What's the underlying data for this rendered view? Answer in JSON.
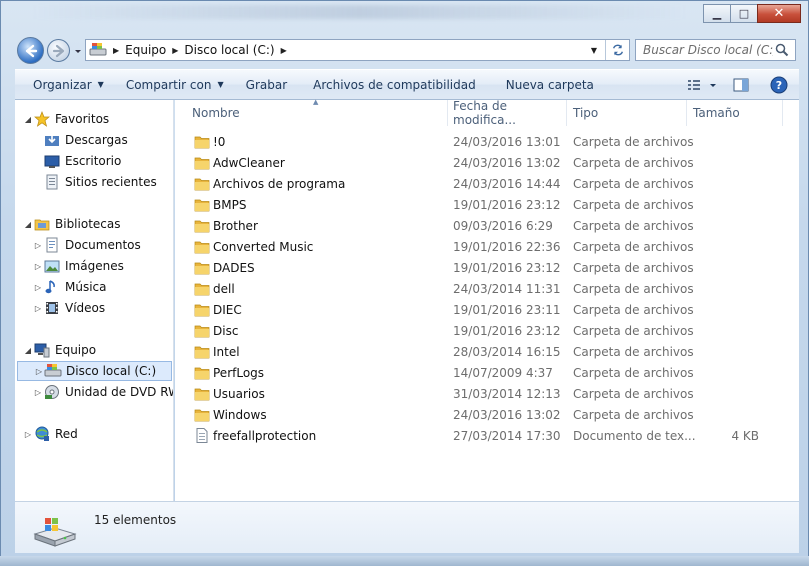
{
  "window": {
    "buttons": {
      "minimize": "▁",
      "maximize": "□",
      "close": "✕"
    }
  },
  "address": {
    "crumbs": [
      "Equipo",
      "Disco local (C:)"
    ]
  },
  "search": {
    "placeholder": "Buscar Disco local (C:)"
  },
  "toolbar": {
    "organize": "Organizar",
    "share": "Compartir con",
    "burn": "Grabar",
    "compat": "Archivos de compatibilidad",
    "new_folder": "Nueva carpeta"
  },
  "sidebar": {
    "favorites": "Favoritos",
    "fav_items": [
      "Descargas",
      "Escritorio",
      "Sitios recientes"
    ],
    "libraries": "Bibliotecas",
    "lib_items": [
      "Documentos",
      "Imágenes",
      "Música",
      "Vídeos"
    ],
    "computer": "Equipo",
    "comp_items": [
      "Disco local (C:)",
      "Unidad de DVD RW ("
    ],
    "network": "Red"
  },
  "columns": {
    "name": "Nombre",
    "date": "Fecha de modifica...",
    "type": "Tipo",
    "size": "Tamaño"
  },
  "files": [
    {
      "name": "!0",
      "date": "24/03/2016 13:01",
      "type": "Carpeta de archivos",
      "size": ""
    },
    {
      "name": "AdwCleaner",
      "date": "24/03/2016 13:02",
      "type": "Carpeta de archivos",
      "size": ""
    },
    {
      "name": "Archivos de programa",
      "date": "24/03/2016 14:44",
      "type": "Carpeta de archivos",
      "size": ""
    },
    {
      "name": "BMPS",
      "date": "19/01/2016 23:12",
      "type": "Carpeta de archivos",
      "size": ""
    },
    {
      "name": "Brother",
      "date": "09/03/2016 6:29",
      "type": "Carpeta de archivos",
      "size": ""
    },
    {
      "name": "Converted Music",
      "date": "19/01/2016 22:36",
      "type": "Carpeta de archivos",
      "size": ""
    },
    {
      "name": "DADES",
      "date": "19/01/2016 23:12",
      "type": "Carpeta de archivos",
      "size": ""
    },
    {
      "name": "dell",
      "date": "24/03/2014 11:31",
      "type": "Carpeta de archivos",
      "size": ""
    },
    {
      "name": "DIEC",
      "date": "19/01/2016 23:11",
      "type": "Carpeta de archivos",
      "size": ""
    },
    {
      "name": "Disc",
      "date": "19/01/2016 23:12",
      "type": "Carpeta de archivos",
      "size": ""
    },
    {
      "name": "Intel",
      "date": "28/03/2014 16:15",
      "type": "Carpeta de archivos",
      "size": ""
    },
    {
      "name": "PerfLogs",
      "date": "14/07/2009 4:37",
      "type": "Carpeta de archivos",
      "size": ""
    },
    {
      "name": "Usuarios",
      "date": "31/03/2014 12:13",
      "type": "Carpeta de archivos",
      "size": ""
    },
    {
      "name": "Windows",
      "date": "24/03/2016 13:02",
      "type": "Carpeta de archivos",
      "size": ""
    },
    {
      "name": "freefallprotection",
      "date": "27/03/2014 17:30",
      "type": "Documento de tex...",
      "size": "4 KB"
    }
  ],
  "status": {
    "count": "15 elementos"
  },
  "colors": {
    "accent": "#1e395b",
    "selection": "#dceafc",
    "folder": "#f3c54a"
  }
}
